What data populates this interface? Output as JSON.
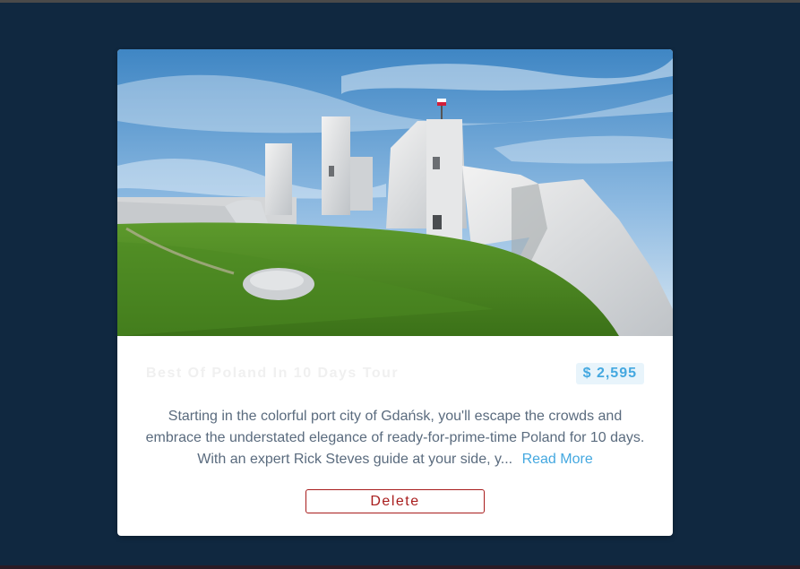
{
  "tour": {
    "title": "Best Of Poland In 10 Days Tour",
    "price": "$ 2,595",
    "description": "Starting in the colorful port city of Gdańsk, you'll escape the crowds and embrace the understated elegance of ready-for-prime-time Poland for 10 days. With an expert Rick Steves guide at your side, y...",
    "read_more_label": "Read More",
    "delete_label": "Delete",
    "image_icon": "castle-ruins-photo"
  },
  "colors": {
    "page_background": "#102840",
    "card_background": "#ffffff",
    "accent": "#44a8e0",
    "danger": "#a81c1c"
  }
}
